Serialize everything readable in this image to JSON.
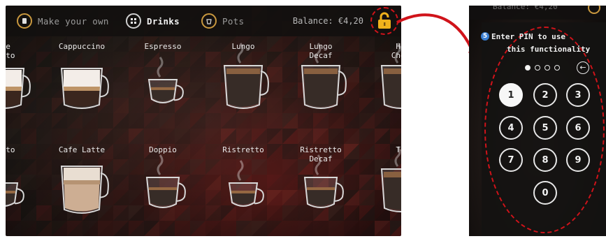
{
  "left_screen": {
    "nav": {
      "make_your_own": "Make your own",
      "drinks": "Drinks",
      "pots": "Pots"
    },
    "balance": "Balance: €4,20",
    "lock_icon": "padlock-open-icon",
    "tiles_row1": [
      {
        "name": "tte\nhiato"
      },
      {
        "name": "Cappuccino"
      },
      {
        "name": "Espresso"
      },
      {
        "name": "Lungo"
      },
      {
        "name": "Lungo\nDecaf"
      },
      {
        "name": "Ho\nChoc"
      }
    ],
    "tiles_row2": [
      {
        "name": "hiato"
      },
      {
        "name": "Cafe Latte"
      },
      {
        "name": "Doppio"
      },
      {
        "name": "Ristretto"
      },
      {
        "name": "Ristretto\nDecaf"
      },
      {
        "name": "Te"
      }
    ]
  },
  "right_screen": {
    "top_text": "Balance: €4,20",
    "step_number": "5",
    "prompt_line1": "Enter PIN to use",
    "prompt_line2": "this functionality",
    "pin_entered": 1,
    "pin_length": 4,
    "backspace_icon": "backspace-arrow-icon",
    "keys": [
      "1",
      "2",
      "3",
      "4",
      "5",
      "6",
      "7",
      "8",
      "9",
      "0"
    ],
    "pressed_key": "1"
  },
  "colors": {
    "accent_gold": "#c9983f",
    "highlight_red": "#d0131a",
    "step_blue": "#3a7fd3"
  }
}
